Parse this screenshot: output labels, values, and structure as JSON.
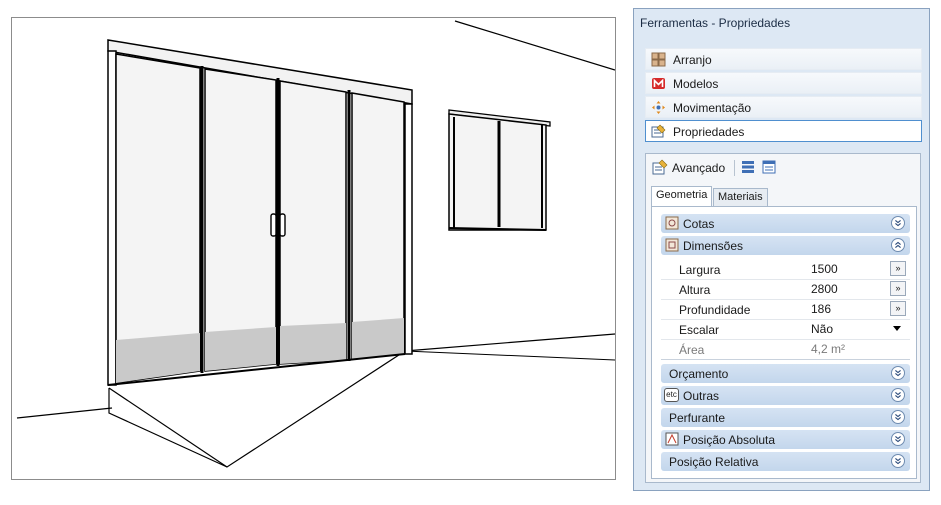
{
  "panel": {
    "title": "Ferramentas - Propriedades",
    "tools": [
      {
        "label": "Arranjo",
        "icon": "arrange-icon"
      },
      {
        "label": "Modelos",
        "icon": "models-icon"
      },
      {
        "label": "Movimentação",
        "icon": "move-icon"
      },
      {
        "label": "Propriedades",
        "icon": "properties-icon",
        "selected": true
      }
    ],
    "advanced_label": "Avançado",
    "tabs": [
      "Geometria",
      "Materiais"
    ],
    "groups": {
      "cotas": "Cotas",
      "dimensoes": "Dimensões",
      "orcamento": "Orçamento",
      "outras": "Outras",
      "perfurante": "Perfurante",
      "posicao_absoluta": "Posição Absoluta",
      "posicao_relativa": "Posição Relativa"
    },
    "dimensions": {
      "largura": {
        "label": "Largura",
        "value": "1500",
        "button": "»"
      },
      "altura": {
        "label": "Altura",
        "value": "2800",
        "button": "»"
      },
      "profundidade": {
        "label": "Profundidade",
        "value": "186",
        "button": "»"
      },
      "escalar": {
        "label": "Escalar",
        "value": "Não"
      },
      "area": {
        "label": "Área",
        "value": "4,2 m²"
      }
    },
    "etc_badge": "etc"
  },
  "colors": {
    "accent": "#4f8fcf",
    "group": "#c9daee",
    "panel": "#dde8f4"
  }
}
